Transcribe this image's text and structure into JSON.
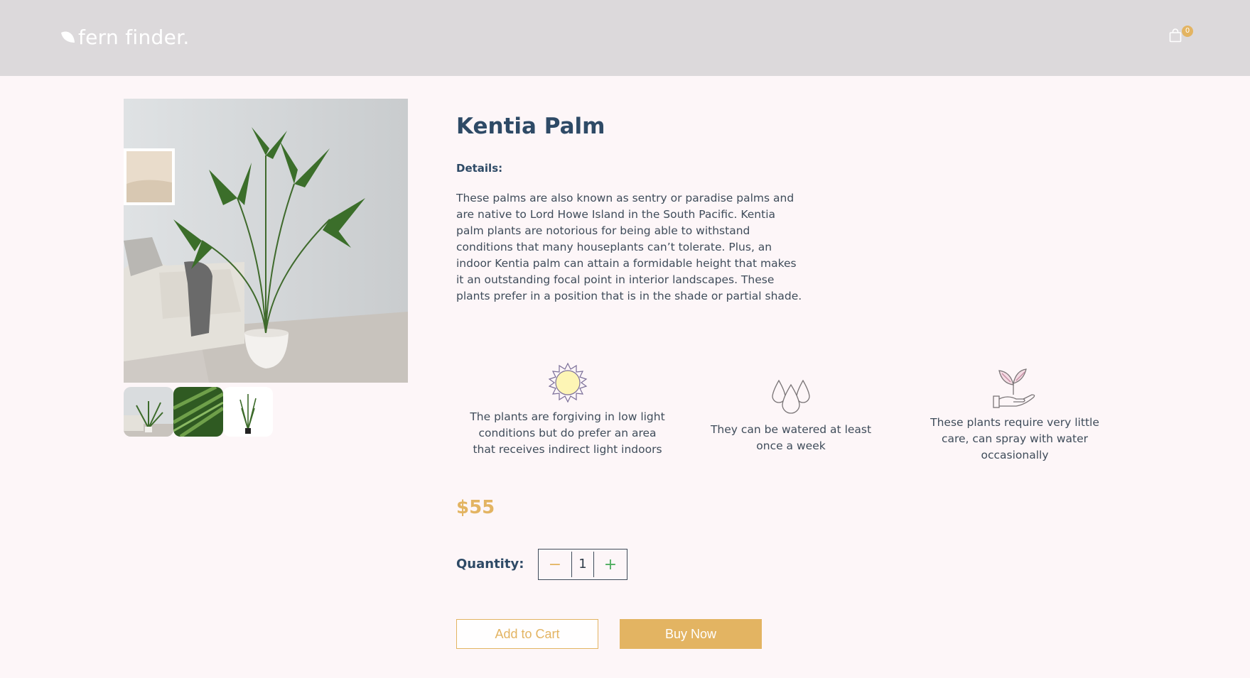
{
  "brand": {
    "name": "fern finder."
  },
  "cart": {
    "count": "0",
    "icon": "shopping-bag-icon"
  },
  "product": {
    "title": "Kentia Palm",
    "details_label": "Details:",
    "description": "These palms are also known as sentry or paradise palms and are native to Lord Howe Island in the South Pacific. Kentia palm plants are notorious for being able to withstand conditions that many houseplants can’t tolerate. Plus, an indoor Kentia palm can attain a formidable height that makes it an outstanding focal point in interior landscapes. These plants prefer in a position that is in the shade or partial shade.",
    "price": "$55"
  },
  "care": [
    {
      "icon": "sun-icon",
      "text": "The plants are forgiving in low light conditions but do prefer an area that receives indirect light indoors"
    },
    {
      "icon": "water-drops-icon",
      "text": "They can be watered at least once a week"
    },
    {
      "icon": "plant-in-hand-icon",
      "text": "These plants require very little care, can spray with water occasionally"
    }
  ],
  "quantity": {
    "label": "Quantity:",
    "value": "1",
    "minus": "−",
    "plus": "+"
  },
  "actions": {
    "add_to_cart": "Add to Cart",
    "buy_now": "Buy Now"
  },
  "colors": {
    "accent": "#e3b462",
    "heading": "#2e4a66",
    "header_bg": "#dcd9db",
    "page_bg": "#fdf6f8"
  }
}
